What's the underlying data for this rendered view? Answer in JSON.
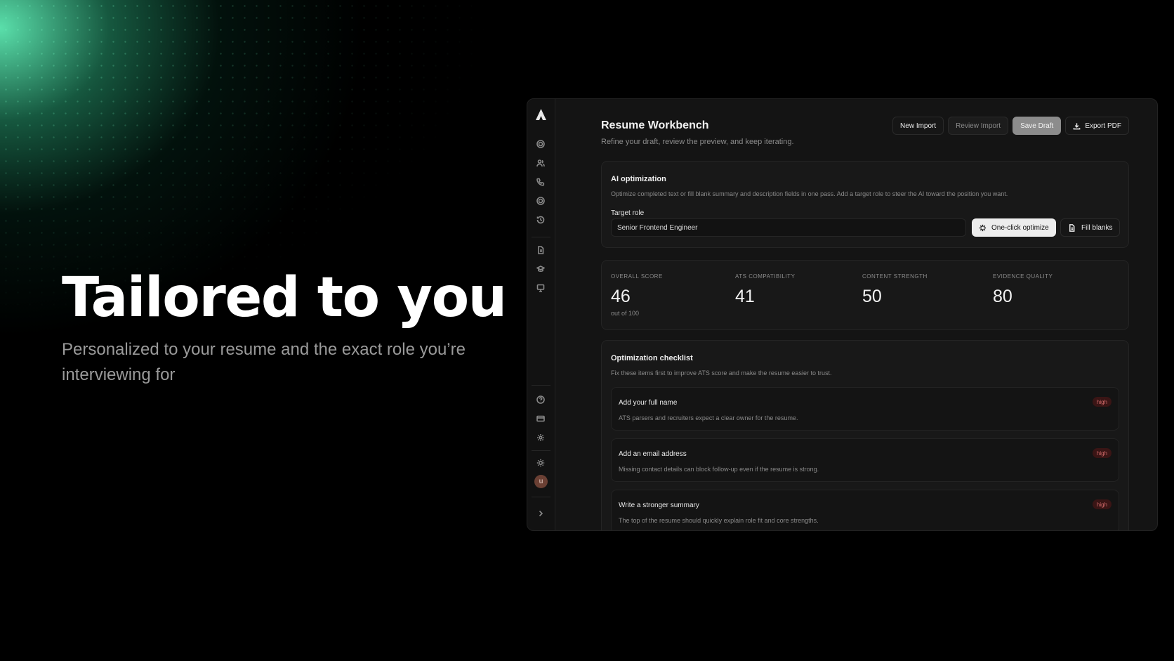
{
  "hero": {
    "title": "Tailored to you",
    "subtitle": "Personalized to your resume and the exact role you’re interviewing for"
  },
  "app": {
    "avatar_initial": "u",
    "header": {
      "title": "Resume Workbench",
      "subtitle": "Refine your draft, review the preview, and keep iterating."
    },
    "toolbar": {
      "new_import": "New Import",
      "review_import": "Review Import",
      "save_draft": "Save Draft",
      "export_pdf": "Export PDF"
    },
    "ai": {
      "title": "AI optimization",
      "description": "Optimize completed text or fill blank summary and description fields in one pass. Add a target role to steer the AI toward the position you want.",
      "target_label": "Target role",
      "target_value": "Senior Frontend Engineer",
      "optimize_label": "One-click optimize",
      "fill_label": "Fill blanks"
    },
    "scores": {
      "overall": {
        "label": "OVERALL SCORE",
        "value": "46",
        "note": "out of 100"
      },
      "ats": {
        "label": "ATS COMPATIBILITY",
        "value": "41"
      },
      "content": {
        "label": "CONTENT STRENGTH",
        "value": "50"
      },
      "evidence": {
        "label": "EVIDENCE QUALITY",
        "value": "80"
      }
    },
    "checklist": {
      "title": "Optimization checklist",
      "description": "Fix these items first to improve ATS score and make the resume easier to trust.",
      "items": [
        {
          "title": "Add your full name",
          "desc": "ATS parsers and recruiters expect a clear owner for the resume.",
          "priority": "high"
        },
        {
          "title": "Add an email address",
          "desc": "Missing contact details can block follow-up even if the resume is strong.",
          "priority": "high"
        },
        {
          "title": "Write a stronger summary",
          "desc": "The top of the resume should quickly explain role fit and core strengths.",
          "priority": "high"
        }
      ]
    }
  },
  "colors": {
    "accent_glow": "#5febb4",
    "badge_high": "#d06a6a"
  },
  "icons": {
    "sidebar": [
      "logo-icon",
      "target-icon",
      "users-icon",
      "phone-icon",
      "target-icon",
      "history-icon",
      "document-icon",
      "graduation-icon",
      "presentation-icon",
      "help-icon",
      "card-icon",
      "gear-icon",
      "sun-icon",
      "chevron-right-icon"
    ]
  }
}
